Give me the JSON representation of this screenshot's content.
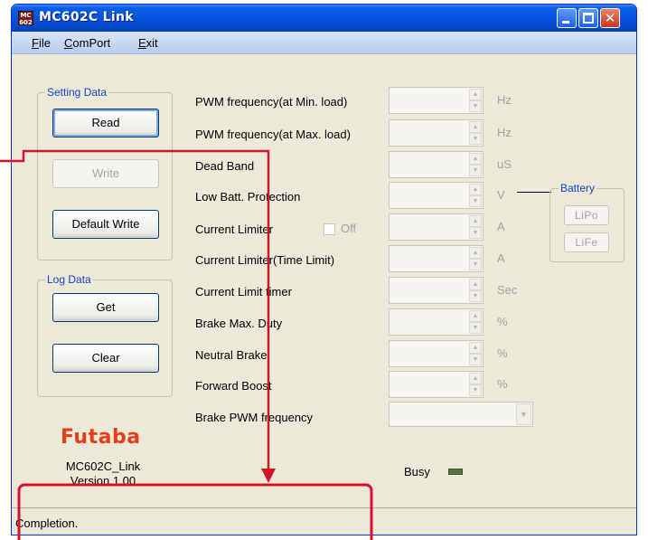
{
  "window": {
    "title": "MC602C Link",
    "icon_text_top": "MC",
    "icon_text_bottom": "602"
  },
  "menu": [
    {
      "label": "File",
      "accel": "F",
      "rest": "ile"
    },
    {
      "label": "ComPort",
      "accel": "C",
      "rest": "omPort"
    },
    {
      "label": "Exit",
      "accel": "E",
      "rest": "xit"
    }
  ],
  "setting_data": {
    "title": "Setting Data",
    "read_label": "Read",
    "write_label": "Write",
    "default_write_label": "Default Write"
  },
  "log_data": {
    "title": "Log Data",
    "get_label": "Get",
    "clear_label": "Clear"
  },
  "params": [
    {
      "label": "PWM frequency(at Min. load)",
      "unit": "Hz"
    },
    {
      "label": "PWM frequency(at Max. load)",
      "unit": "Hz"
    },
    {
      "label": "Dead Band",
      "unit": "uS"
    },
    {
      "label": "Low Batt. Protection",
      "unit": "V"
    },
    {
      "label": "Current Limiter",
      "unit": "A"
    },
    {
      "label": "Current Limiter(Time Limit)",
      "unit": "A"
    },
    {
      "label": "Current Limit timer",
      "unit": "Sec"
    },
    {
      "label": "Brake Max. Duty",
      "unit": "%"
    },
    {
      "label": "Neutral Brake",
      "unit": "%"
    },
    {
      "label": "Forward Boost",
      "unit": "%"
    }
  ],
  "current_limiter_off": "Off",
  "brake_pwm_label": "Brake PWM frequency",
  "battery": {
    "title": "Battery",
    "lipo": "LiPo",
    "life": "LiFe"
  },
  "brand": {
    "logo": "Futaba",
    "app_name": "MC602C_Link",
    "version": "Version 1.00"
  },
  "busy_label": "Busy",
  "status_text": "Completion.",
  "colors": {
    "annotation": "#d0152a",
    "title_bar": "#0553e0",
    "group_title": "#1645c4",
    "logo": "#e0401c"
  }
}
